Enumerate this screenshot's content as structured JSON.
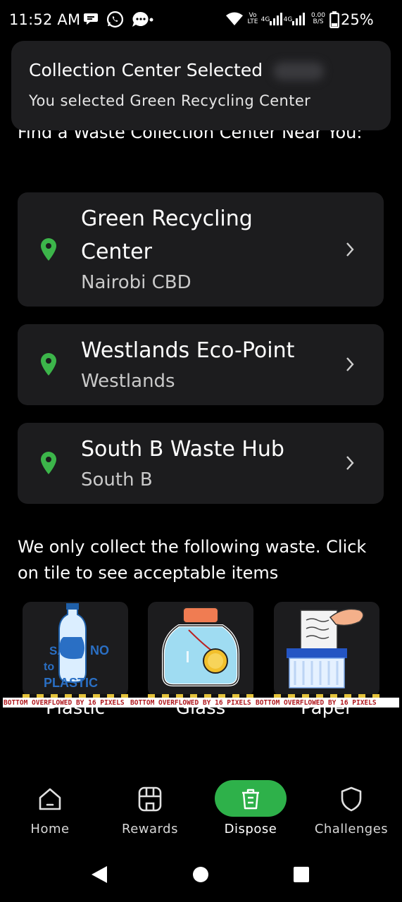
{
  "status_bar": {
    "time": "11:52 AM",
    "network_top": "Vo",
    "network_bottom": "LTE",
    "net_4g_1": "4G",
    "net_4g_2": "4G",
    "speed_top": "0.00",
    "speed_bottom": "B/S",
    "battery": "25%"
  },
  "toast": {
    "title": "Collection Center Selected",
    "message": "You selected Green Recycling Center"
  },
  "heading": "Find a Waste Collection Center Near You:",
  "centers": [
    {
      "name": "Green Recycling Center",
      "location": "Nairobi CBD"
    },
    {
      "name": "Westlands Eco-Point",
      "location": "Westlands"
    },
    {
      "name": "South B Waste Hub",
      "location": "South B"
    }
  ],
  "waste_heading": "We only collect the following waste. Click on tile to see acceptable items",
  "tiles": [
    {
      "label": "Plastic",
      "image_text_1": "SAY",
      "image_text_2": "NO",
      "image_text_3": "to",
      "image_text_4": "PLASTIC"
    },
    {
      "label": "Glass"
    },
    {
      "label": "Paper"
    }
  ],
  "overflow_warnings": [
    "BOTTOM OVERFLOWED BY 16 PIXELS",
    "BOTTOM OVERFLOWED BY 16 PIXELS",
    "BOTTOM OVERFLOWED BY 16 PIXELS"
  ],
  "bottom_nav": {
    "active": "Dispose",
    "items": [
      {
        "label": "Home",
        "icon": "home-icon"
      },
      {
        "label": "Rewards",
        "icon": "store-icon"
      },
      {
        "label": "Dispose",
        "icon": "trash-icon"
      },
      {
        "label": "Challenges",
        "icon": "shield-icon"
      }
    ]
  },
  "colors": {
    "accent_green": "#2eb14a",
    "pin_green": "#3cb54a",
    "card_bg": "#1c1c1e",
    "toast_bg": "#1e1e20",
    "overflow_red": "#b0181e"
  }
}
